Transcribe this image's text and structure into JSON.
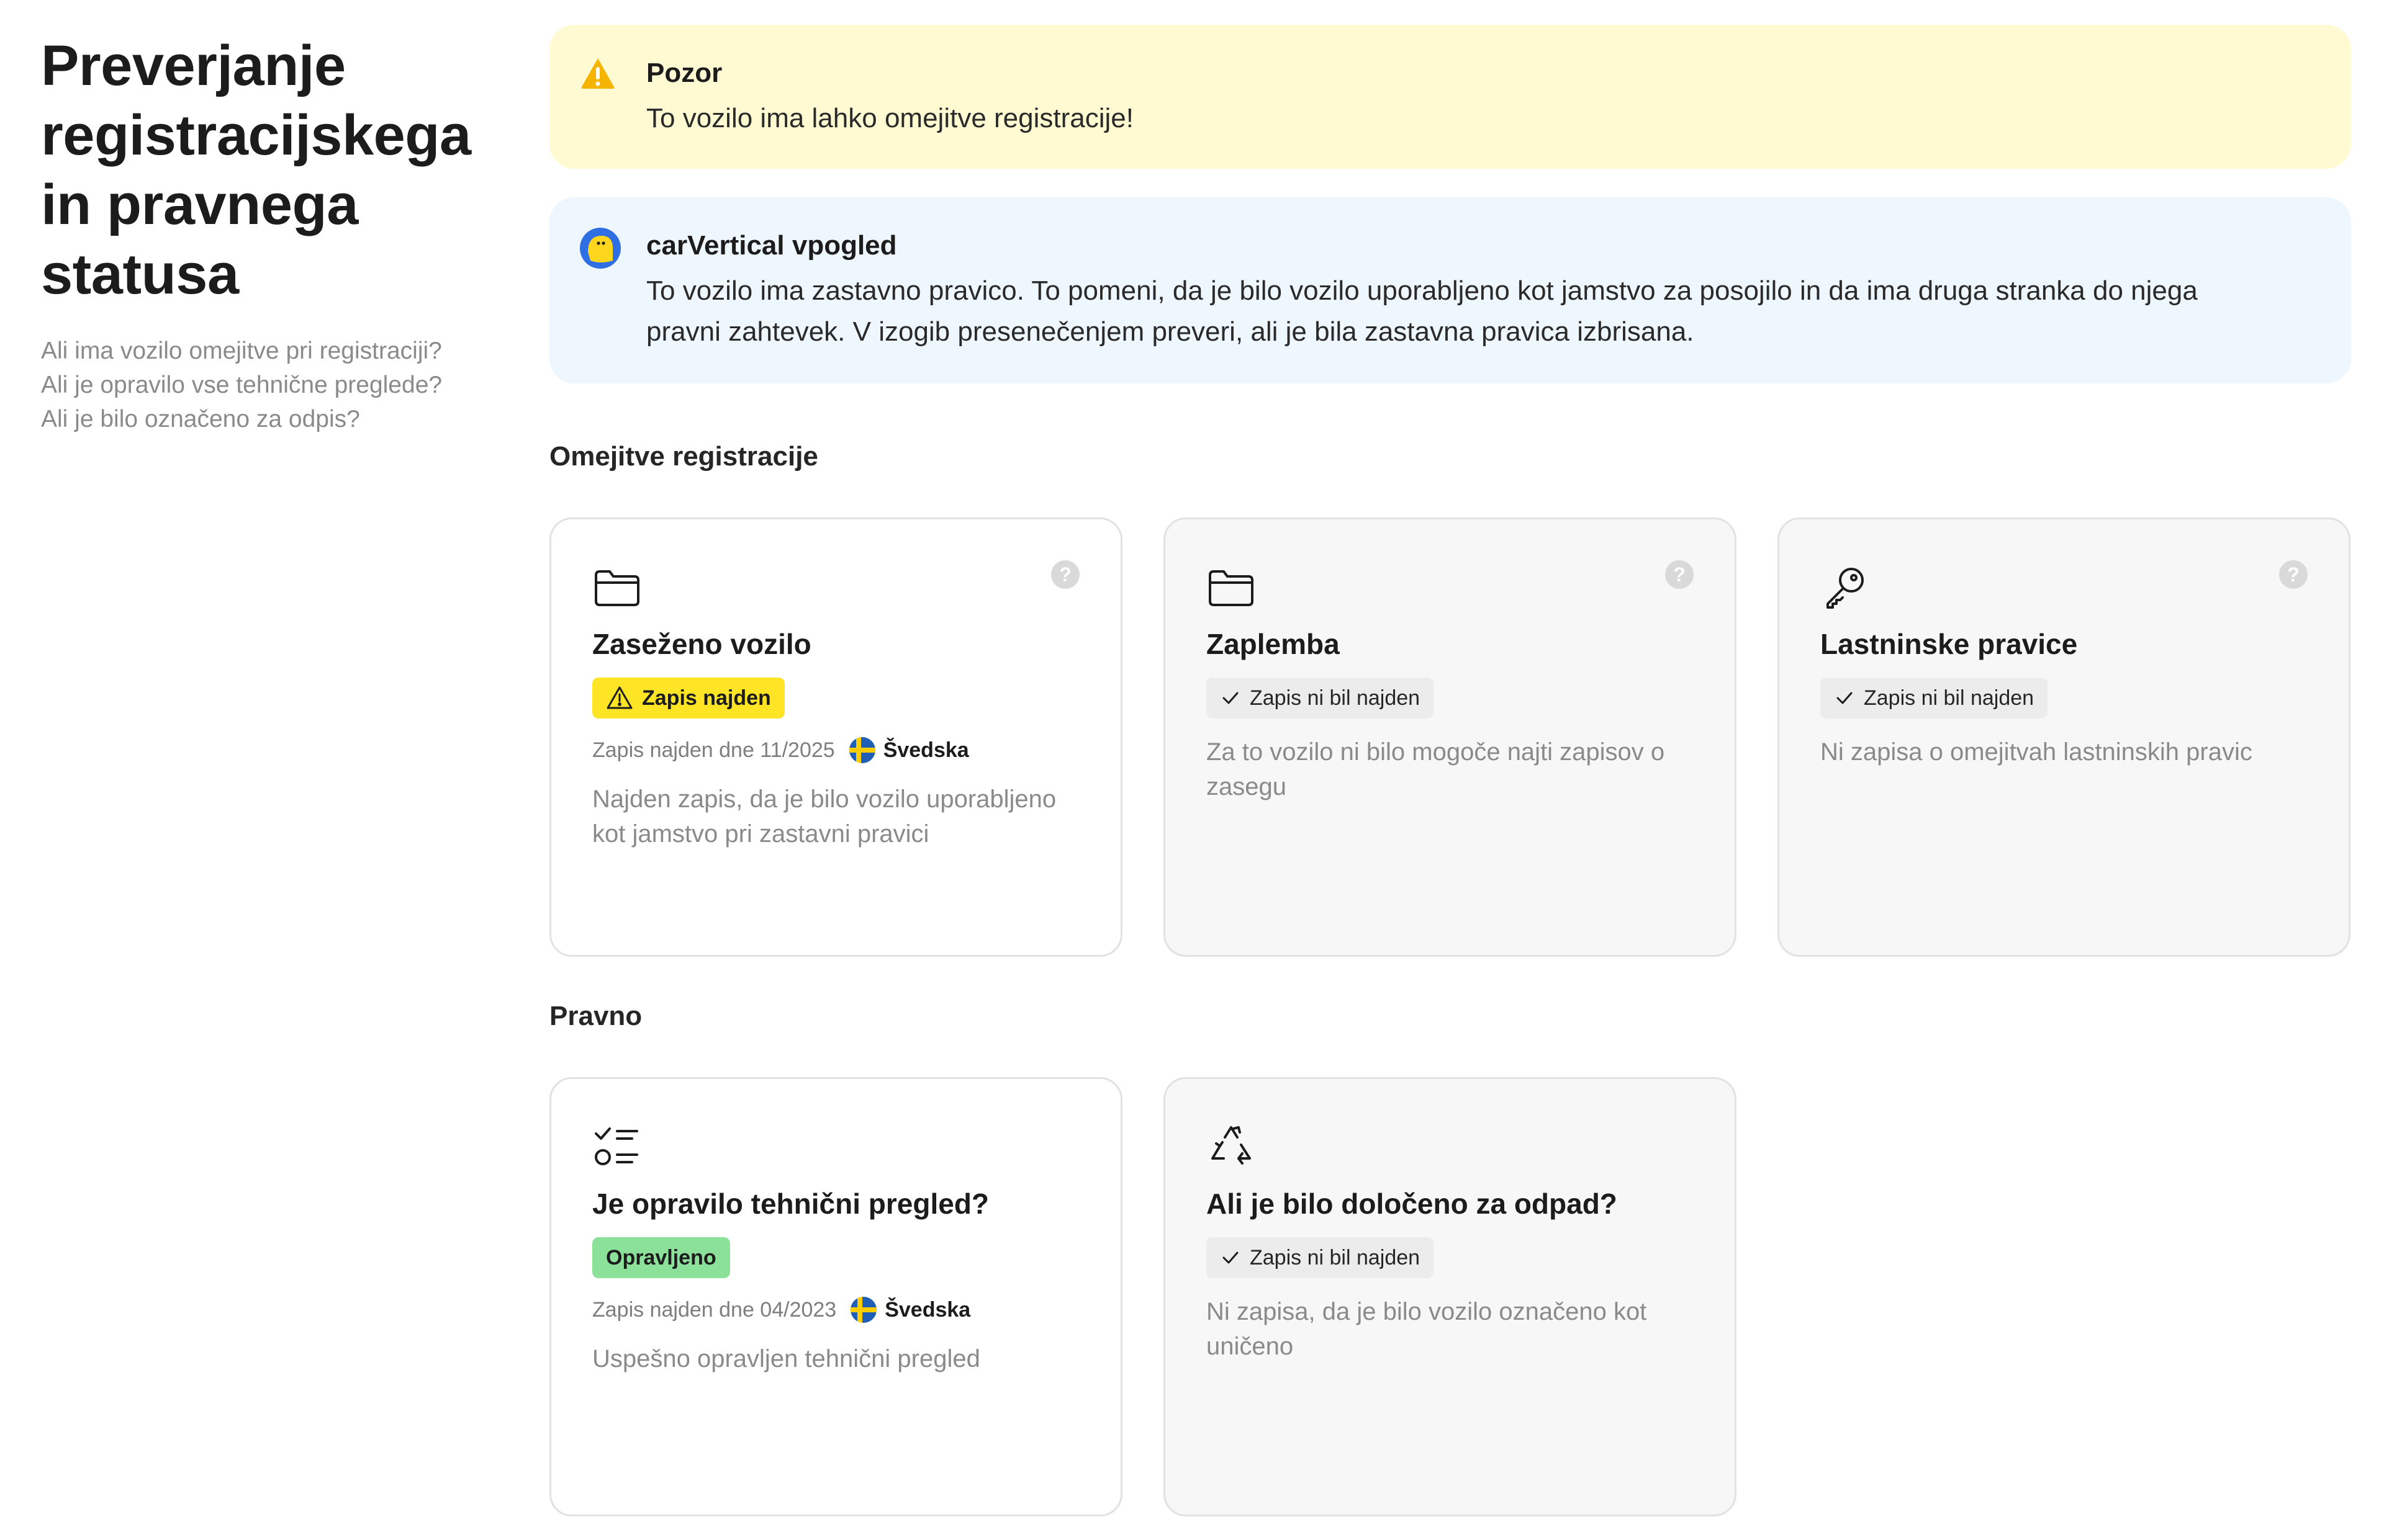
{
  "left": {
    "title_lines": [
      "Preverjanje",
      "registracijskega",
      "in pravnega",
      "statusa"
    ],
    "questions": [
      "Ali ima vozilo omejitve pri registraciji?",
      "Ali je opravilo vse tehnične preglede?",
      "Ali je bilo označeno za odpis?"
    ]
  },
  "warning": {
    "title": "Pozor",
    "text": "To vozilo ima lahko omejitve registracije!",
    "icon": "warning-triangle-icon",
    "color": "#fffad1"
  },
  "insight": {
    "title": "carVertical vpogled",
    "text_lines": [
      "To vozilo ima zastavno pravico. To pomeni, da je bilo vozilo uporabljeno kot jamstvo za posojilo in da ima druga stranka do njega",
      "pravni zahtevek. V izogib presenečenjem preveri, ali je bila zastavna pravica izbrisana."
    ],
    "icon": "carvertical-logo-icon",
    "color": "#eef6fe"
  },
  "sections": {
    "registration": {
      "title": "Omejitve registracije",
      "cards": [
        {
          "title": "Zaseženo vozilo",
          "icon": "folder-icon",
          "badge": "Zapis najden",
          "badge_type": "found",
          "meta": "Zapis najden dne 11/2025",
          "country": "Švedska",
          "desc_lines": [
            "Najden zapis, da je bilo vozilo uporabljeno",
            "kot jamstvo pri zastavni pravici"
          ],
          "help": "?"
        },
        {
          "title": "Zaplemba",
          "icon": "folder-icon",
          "badge": "Zapis ni bil najden",
          "badge_type": "ok",
          "desc_lines": [
            "Za to vozilo ni bilo mogoče najti zapisov o",
            "zasegu"
          ],
          "help": "?"
        },
        {
          "title": "Lastninske pravice",
          "icon": "key-icon",
          "badge": "Zapis ni bil najden",
          "badge_type": "ok",
          "desc_lines": [
            "Ni zapisa o omejitvah lastninskih pravic"
          ],
          "help": "?"
        }
      ]
    },
    "legal": {
      "title": "Pravno",
      "cards": [
        {
          "title": "Je opravilo tehnični pregled?",
          "icon": "checklist-icon",
          "badge": "Opravljeno",
          "badge_type": "passed",
          "meta": "Zapis najden dne 04/2023",
          "country": "Švedska",
          "desc_lines": [
            "Uspešno opravljen tehnični pregled"
          ]
        },
        {
          "title": "Ali je bilo določeno za odpad?",
          "icon": "recycle-icon",
          "badge": "Zapis ni bil najden",
          "badge_type": "ok",
          "desc_lines": [
            "Ni zapisa, da je bilo vozilo označeno kot",
            "uničeno"
          ]
        }
      ]
    }
  }
}
